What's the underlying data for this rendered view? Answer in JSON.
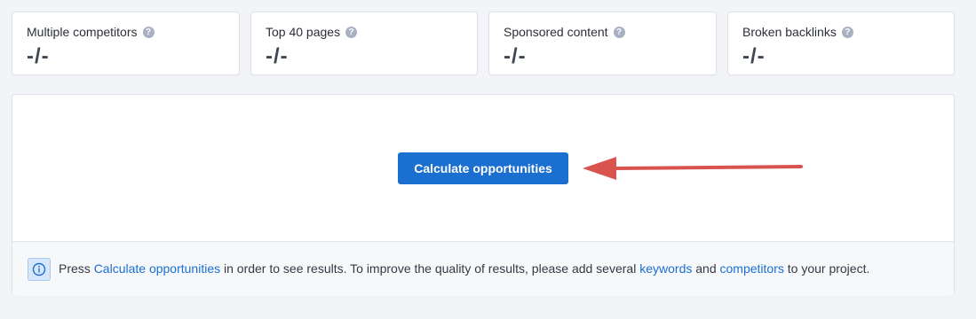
{
  "metrics": [
    {
      "title": "Multiple competitors",
      "value": "-/-"
    },
    {
      "title": "Top 40 pages",
      "value": "-/-"
    },
    {
      "title": "Sponsored content",
      "value": "-/-"
    },
    {
      "title": "Broken backlinks",
      "value": "-/-"
    }
  ],
  "help_icon_glyph": "?",
  "main": {
    "button_label": "Calculate opportunities",
    "info": {
      "part1": "Press ",
      "link1": "Calculate opportunities",
      "part2": " in order to see results. To improve the quality of results, please add several ",
      "link2": "keywords",
      "part3": " and ",
      "link3": "competitors",
      "part4": " to your project."
    }
  },
  "colors": {
    "accent": "#1a6fd1",
    "arrow": "#d9534f",
    "background": "#f3f4f8"
  },
  "icons": {
    "help": "question-circle-icon",
    "info": "info-circle-icon",
    "arrow": "arrow-left-icon"
  }
}
